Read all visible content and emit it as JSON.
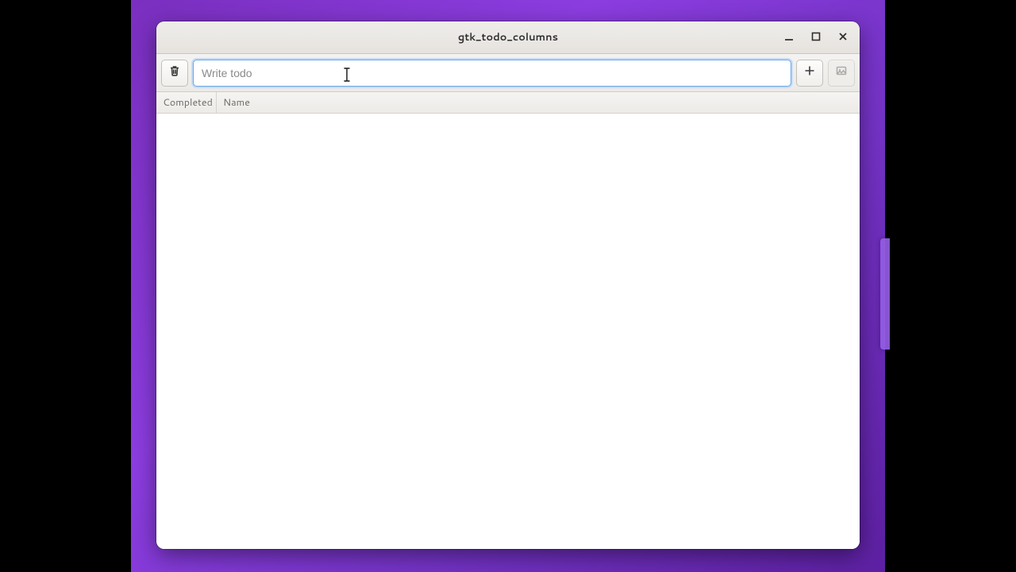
{
  "window": {
    "title": "gtk_todo_columns"
  },
  "toolbar": {
    "input_placeholder": "Write todo",
    "input_value": ""
  },
  "columns": {
    "completed": "Completed",
    "name": "Name"
  },
  "rows": []
}
